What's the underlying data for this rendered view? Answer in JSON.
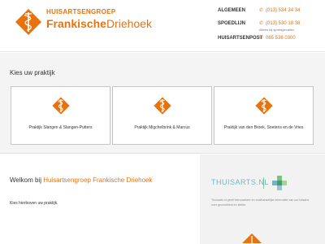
{
  "header": {
    "logo": {
      "top_text": "HUISARTSENGROEP",
      "main_bold": "Frankische",
      "main_light": "Driehoek"
    },
    "contacts": [
      {
        "label": "ALGEMEEN",
        "icon": "phone-icon",
        "number": "(013) 534 34 34",
        "sub": ""
      },
      {
        "label": "SPOEDLIJN",
        "icon": "phone-icon",
        "number": "(013) 530 18 38",
        "sub": "Alleen bij spoedgevallen"
      },
      {
        "label": "HUISARTSENPOST",
        "icon": "phone-icon",
        "number": "085 536 0300",
        "sub": ""
      }
    ]
  },
  "kies": {
    "title": "Kies uw praktijk",
    "cards": [
      {
        "icon": "caduceus-icon",
        "label": "Praktijk Slangen & Slangen-Putters"
      },
      {
        "icon": "caduceus-icon",
        "label": "Praktijk Migchelbrink & Marcus"
      },
      {
        "icon": "caduceus-icon",
        "label": "Praktijk van den Broek, Soetens en de Vries"
      }
    ]
  },
  "welcome": {
    "prefix": "Welkom bij ",
    "brand": "Huisartsengroep Frankische Driehoek",
    "hint": "Kies hierboven uw praktijk."
  },
  "thuisarts": {
    "logo": "THUISARTS.NL",
    "description": "Thuisarts.nl geeft betrouwbare en onafhankelijke informatie van uw huisarts over gezondheid en ziekte."
  },
  "colors": {
    "brand": "#e8730c",
    "thuisarts_blue": "#6cb9c2",
    "thuisarts_green": "#7fbf7f"
  }
}
